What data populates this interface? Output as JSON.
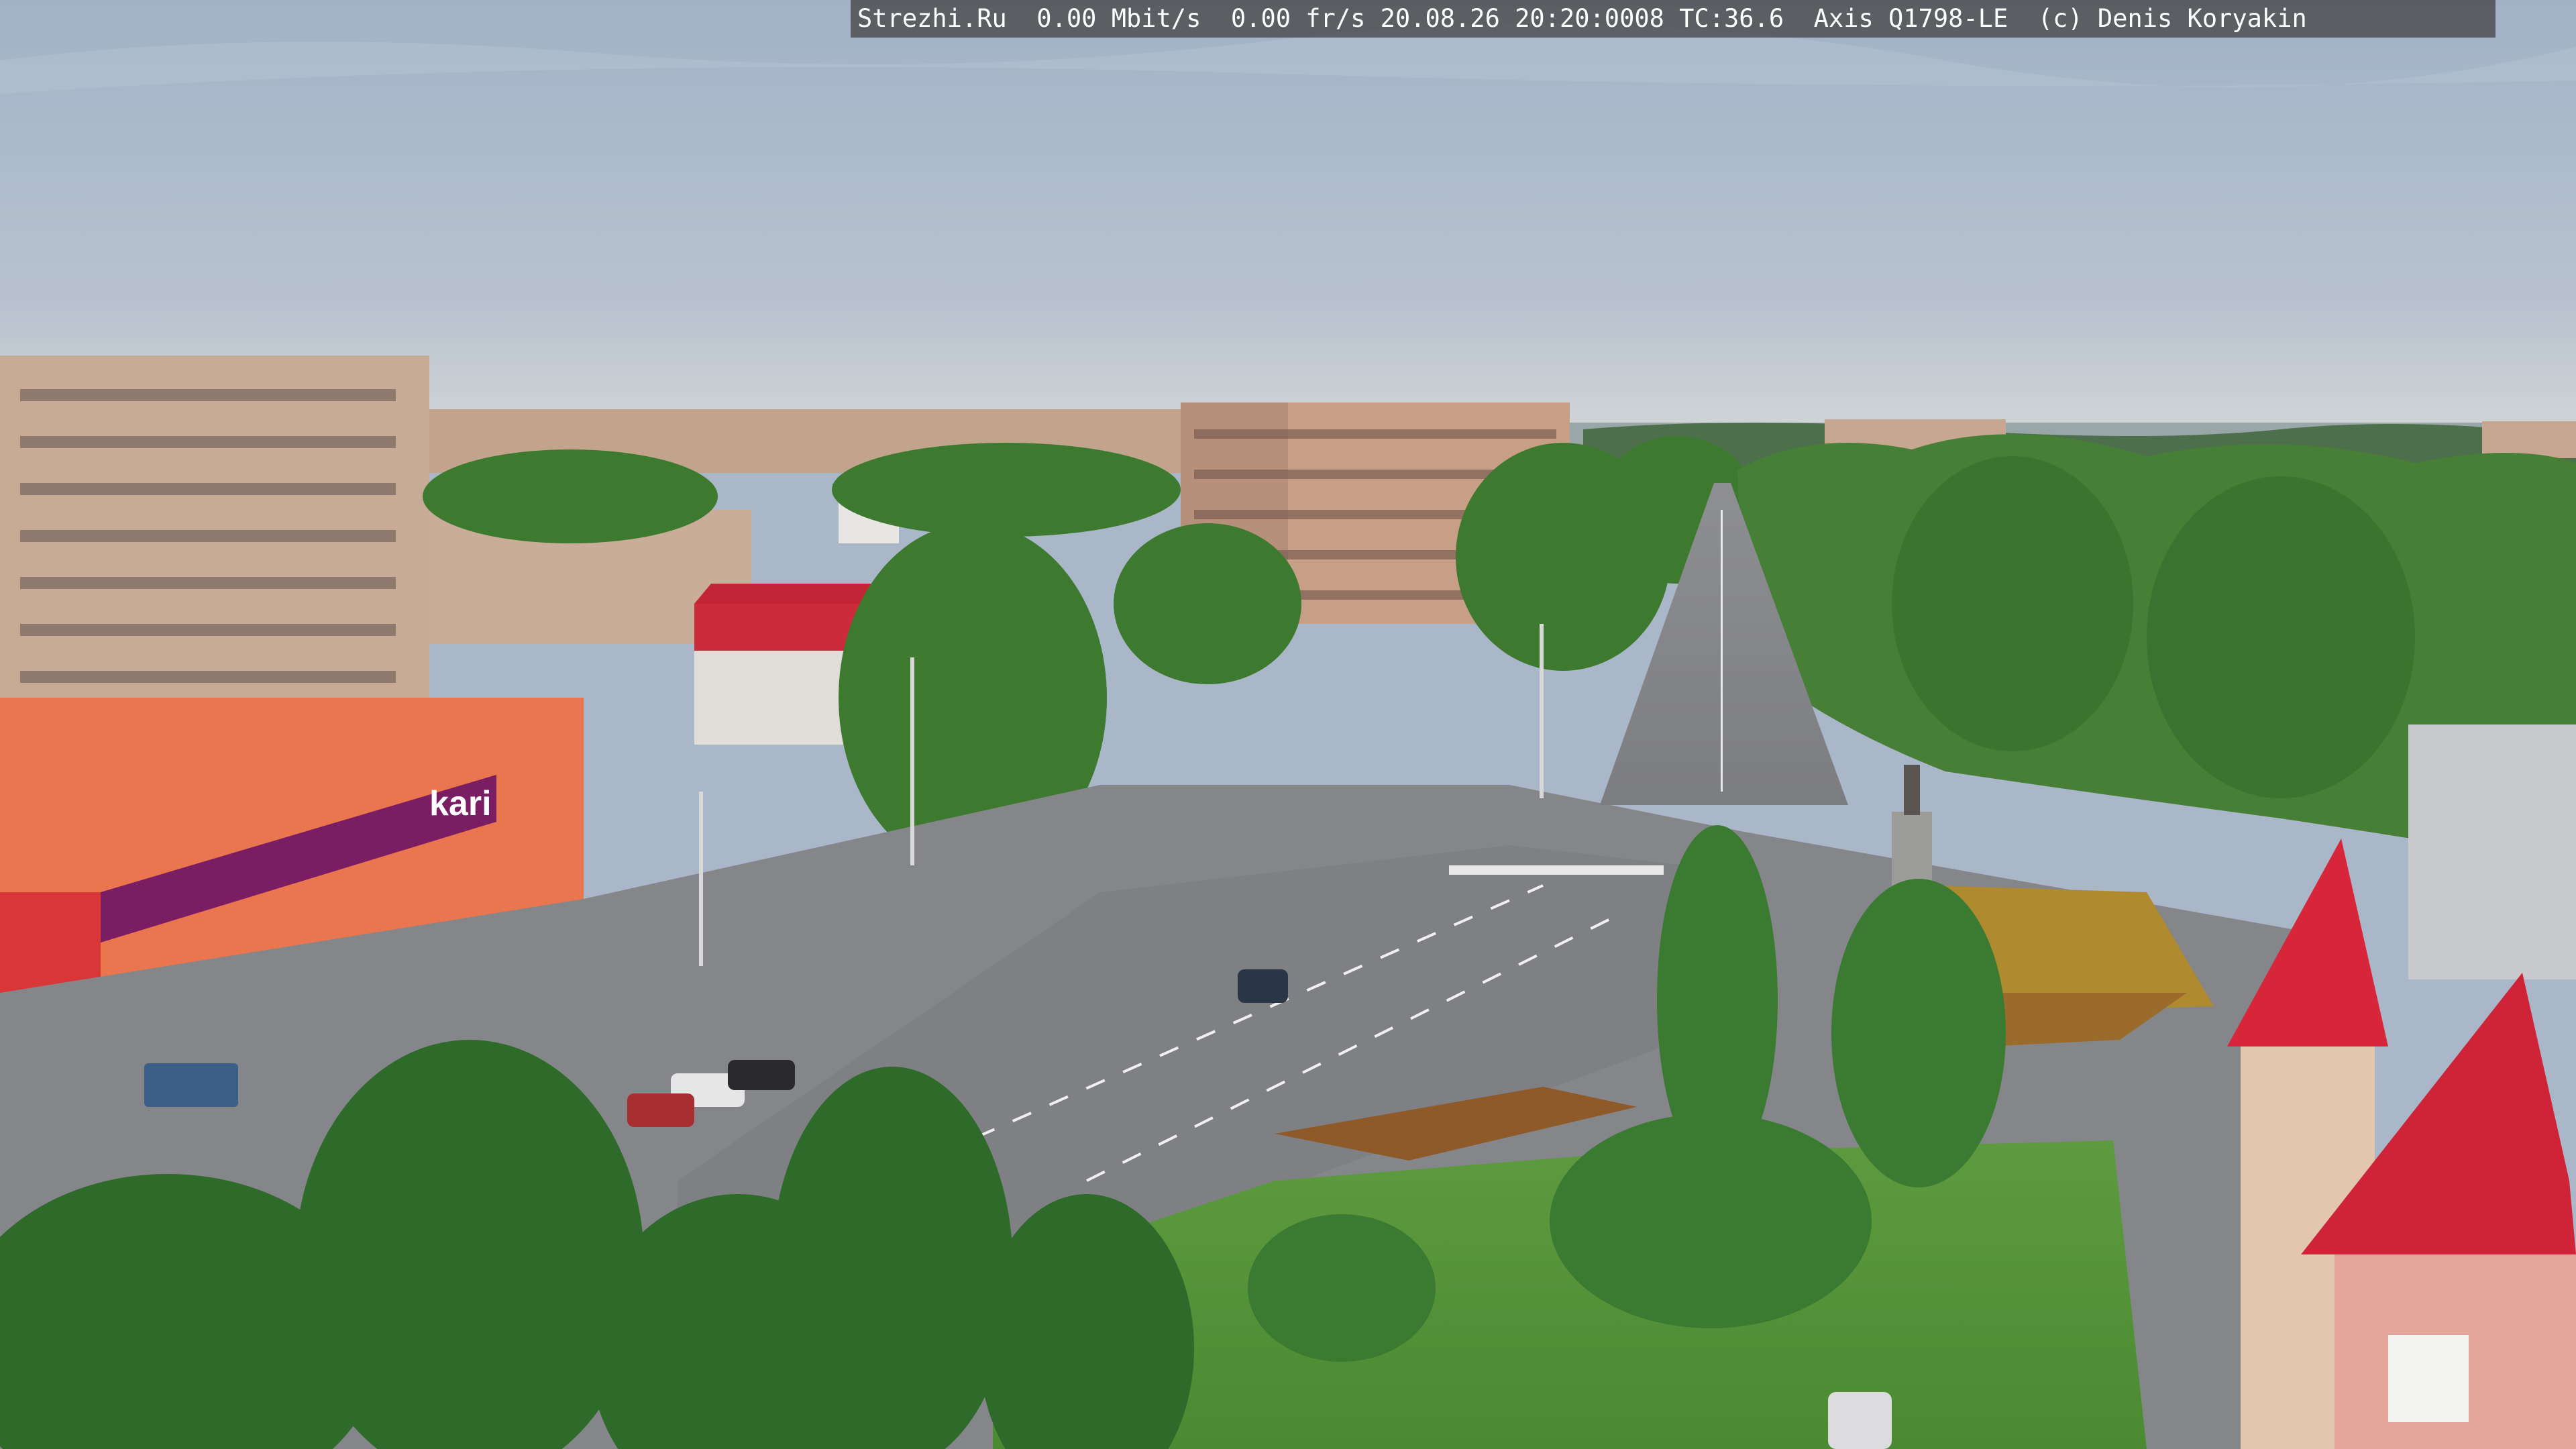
{
  "osd": {
    "text": "Strezhi.Ru  0.00 Mbit/s  0.00 fr/s 20.08.26 20:20:0008 TC:36.6  Axis Q1798-LE  (c) Denis Koryakin"
  },
  "storefront": {
    "brand_sign": "kari"
  },
  "colors": {
    "sky_top": "#a4b4c8",
    "sky_horizon": "#cdd3d8",
    "facade": "#c9ab92",
    "roof_red": "#d42a3b",
    "tree": "#3f7a33",
    "asphalt": "#8c8d90"
  }
}
